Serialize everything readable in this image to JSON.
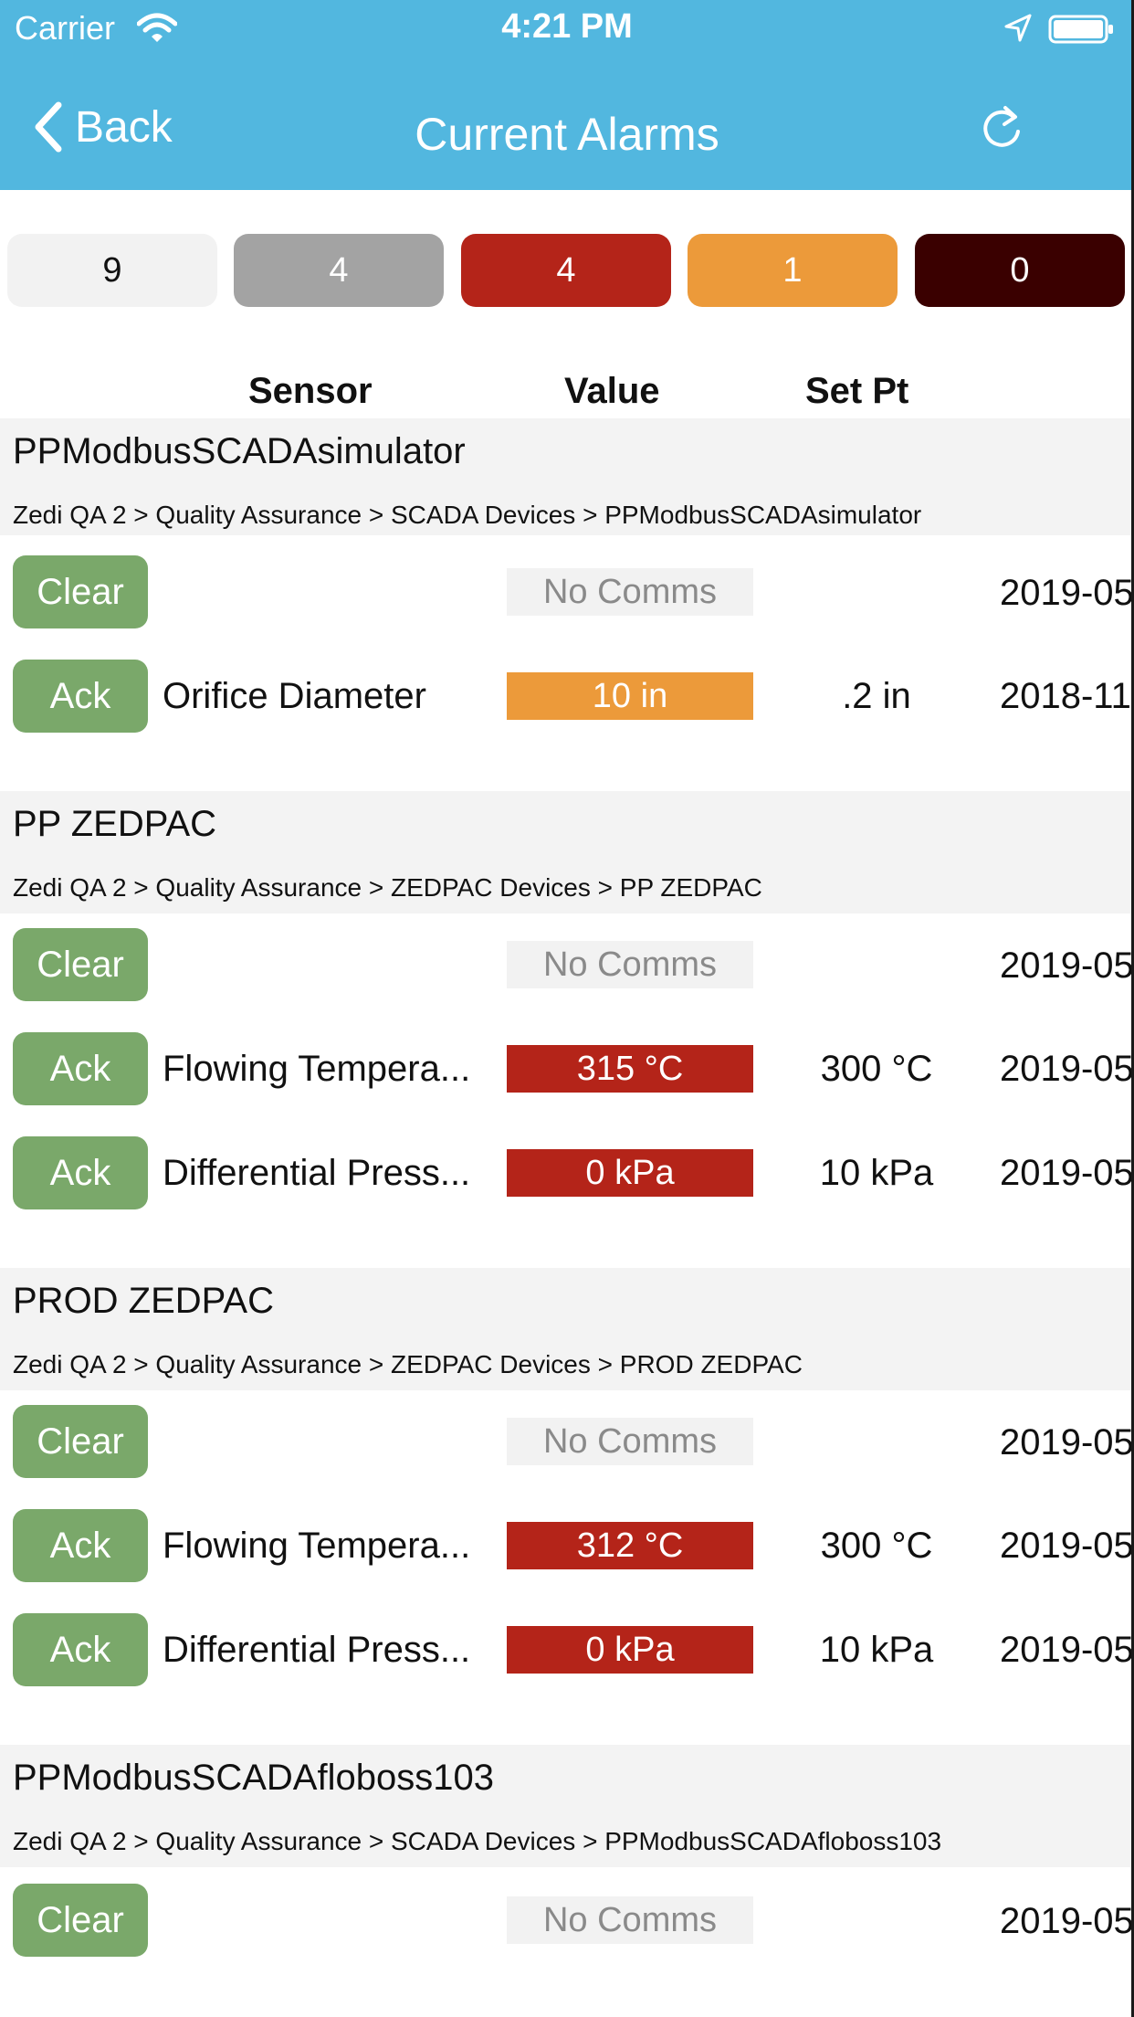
{
  "status_bar": {
    "carrier": "Carrier",
    "time": "4:21 PM"
  },
  "nav": {
    "back_label": "Back",
    "title": "Current Alarms"
  },
  "counters": {
    "all": "9",
    "grey": "4",
    "red": "4",
    "orange": "1",
    "dark": "0"
  },
  "columns": {
    "sensor": "Sensor",
    "value": "Value",
    "setpt": "Set Pt"
  },
  "colors": {
    "nav_bar": "#52b7df",
    "button_green": "#7aa86a",
    "alarm_red": "#b42419",
    "alarm_orange": "#ec9a3a",
    "alarm_dark": "#3a0000"
  },
  "groups": [
    {
      "name": "PPModbusSCADAsimulator",
      "path": "Zedi QA 2 > Quality Assurance > SCADA Devices > PPModbusSCADAsimulator",
      "rows": [
        {
          "button": "Clear",
          "sensor": "",
          "value": "No Comms",
          "setpt": "",
          "date": "2019-05"
        },
        {
          "button": "Ack",
          "sensor": "Orifice Diameter",
          "value": "10 in",
          "setpt": ".2 in",
          "date": "2018-11"
        }
      ]
    },
    {
      "name": "PP ZEDPAC",
      "path": "Zedi QA 2 > Quality Assurance > ZEDPAC Devices > PP ZEDPAC",
      "rows": [
        {
          "button": "Clear",
          "sensor": "",
          "value": "No Comms",
          "setpt": "",
          "date": "2019-05"
        },
        {
          "button": "Ack",
          "sensor": "Flowing Tempera...",
          "value": "315 °C",
          "setpt": "300 °C",
          "date": "2019-05"
        },
        {
          "button": "Ack",
          "sensor": "Differential Press...",
          "value": "0 kPa",
          "setpt": "10 kPa",
          "date": "2019-05"
        }
      ]
    },
    {
      "name": "PROD ZEDPAC",
      "path": "Zedi QA 2 > Quality Assurance > ZEDPAC Devices > PROD ZEDPAC",
      "rows": [
        {
          "button": "Clear",
          "sensor": "",
          "value": "No Comms",
          "setpt": "",
          "date": "2019-05"
        },
        {
          "button": "Ack",
          "sensor": "Flowing Tempera...",
          "value": "312 °C",
          "setpt": "300 °C",
          "date": "2019-05"
        },
        {
          "button": "Ack",
          "sensor": "Differential Press...",
          "value": "0 kPa",
          "setpt": "10 kPa",
          "date": "2019-05"
        }
      ]
    },
    {
      "name": "PPModbusSCADAfloboss103",
      "path": "Zedi QA 2 > Quality Assurance > SCADA Devices > PPModbusSCADAfloboss103",
      "rows": [
        {
          "button": "Clear",
          "sensor": "",
          "value": "No Comms",
          "setpt": "",
          "date": "2019-05"
        }
      ]
    }
  ]
}
